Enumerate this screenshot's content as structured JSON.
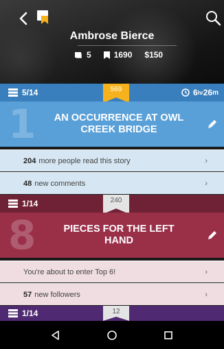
{
  "header": {
    "author_name": "Ambrose Bierce",
    "stats": {
      "books": "5",
      "bookmarks": "1690",
      "earnings": "$150"
    }
  },
  "stories": [
    {
      "progress": "5/14",
      "tag": "569",
      "time": "6hr26m",
      "time_parts": {
        "h": "6",
        "hr": "hr",
        "m": "26",
        "mm": "m"
      },
      "rank": "1",
      "title": "AN OCCURRENCE AT OWL CREEK BRIDGE",
      "rows": [
        {
          "strong": "204",
          "text": "more people read this story",
          "chevron": "›"
        },
        {
          "strong": "48",
          "text": "new comments",
          "chevron": "›"
        }
      ]
    },
    {
      "progress": "1/14",
      "tag": "240",
      "rank": "8",
      "title": "PIECES FOR THE LEFT HAND",
      "rows": [
        {
          "strong": "",
          "text": "You're about to enter Top 6!",
          "chevron": "›"
        },
        {
          "strong": "57",
          "text": "new followers",
          "chevron": "›"
        }
      ]
    },
    {
      "progress": "1/14",
      "tag": "12"
    }
  ],
  "colors": {
    "accent_yellow": "#f6b21c",
    "story1_bar": "#3a7fbd",
    "story1_title": "#5aa0d8",
    "story2_bar": "#6f2235",
    "story2_title": "#9a2f48",
    "story3_bar": "#4f2a73"
  },
  "icons": {
    "back": "back-arrow-icon",
    "logo": "bookmark-logo-icon",
    "search": "search-icon",
    "edit": "pencil-icon",
    "clock": "clock-icon",
    "list": "list-icon"
  }
}
